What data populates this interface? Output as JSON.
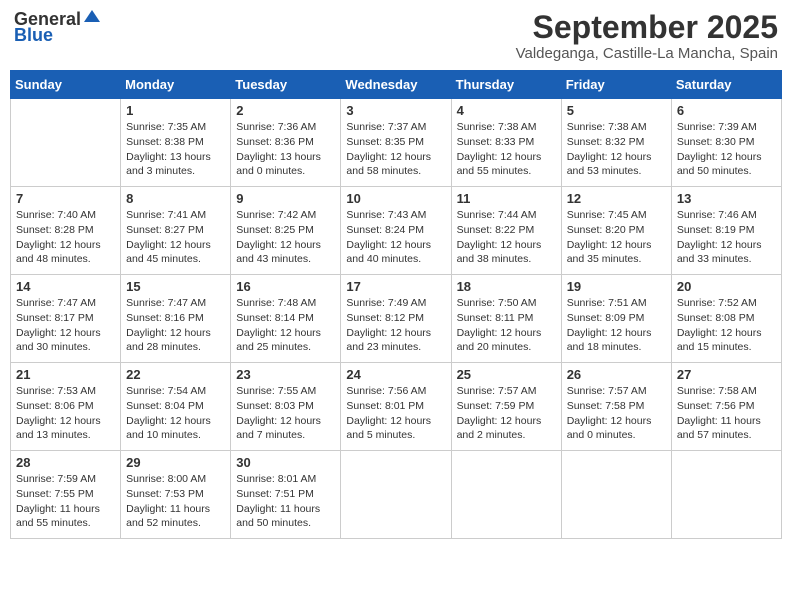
{
  "header": {
    "logo_general": "General",
    "logo_blue": "Blue",
    "month_title": "September 2025",
    "location": "Valdeganga, Castille-La Mancha, Spain"
  },
  "days_of_week": [
    "Sunday",
    "Monday",
    "Tuesday",
    "Wednesday",
    "Thursday",
    "Friday",
    "Saturday"
  ],
  "weeks": [
    [
      {
        "day": "",
        "info": ""
      },
      {
        "day": "1",
        "info": "Sunrise: 7:35 AM\nSunset: 8:38 PM\nDaylight: 13 hours\nand 3 minutes."
      },
      {
        "day": "2",
        "info": "Sunrise: 7:36 AM\nSunset: 8:36 PM\nDaylight: 13 hours\nand 0 minutes."
      },
      {
        "day": "3",
        "info": "Sunrise: 7:37 AM\nSunset: 8:35 PM\nDaylight: 12 hours\nand 58 minutes."
      },
      {
        "day": "4",
        "info": "Sunrise: 7:38 AM\nSunset: 8:33 PM\nDaylight: 12 hours\nand 55 minutes."
      },
      {
        "day": "5",
        "info": "Sunrise: 7:38 AM\nSunset: 8:32 PM\nDaylight: 12 hours\nand 53 minutes."
      },
      {
        "day": "6",
        "info": "Sunrise: 7:39 AM\nSunset: 8:30 PM\nDaylight: 12 hours\nand 50 minutes."
      }
    ],
    [
      {
        "day": "7",
        "info": "Sunrise: 7:40 AM\nSunset: 8:28 PM\nDaylight: 12 hours\nand 48 minutes."
      },
      {
        "day": "8",
        "info": "Sunrise: 7:41 AM\nSunset: 8:27 PM\nDaylight: 12 hours\nand 45 minutes."
      },
      {
        "day": "9",
        "info": "Sunrise: 7:42 AM\nSunset: 8:25 PM\nDaylight: 12 hours\nand 43 minutes."
      },
      {
        "day": "10",
        "info": "Sunrise: 7:43 AM\nSunset: 8:24 PM\nDaylight: 12 hours\nand 40 minutes."
      },
      {
        "day": "11",
        "info": "Sunrise: 7:44 AM\nSunset: 8:22 PM\nDaylight: 12 hours\nand 38 minutes."
      },
      {
        "day": "12",
        "info": "Sunrise: 7:45 AM\nSunset: 8:20 PM\nDaylight: 12 hours\nand 35 minutes."
      },
      {
        "day": "13",
        "info": "Sunrise: 7:46 AM\nSunset: 8:19 PM\nDaylight: 12 hours\nand 33 minutes."
      }
    ],
    [
      {
        "day": "14",
        "info": "Sunrise: 7:47 AM\nSunset: 8:17 PM\nDaylight: 12 hours\nand 30 minutes."
      },
      {
        "day": "15",
        "info": "Sunrise: 7:47 AM\nSunset: 8:16 PM\nDaylight: 12 hours\nand 28 minutes."
      },
      {
        "day": "16",
        "info": "Sunrise: 7:48 AM\nSunset: 8:14 PM\nDaylight: 12 hours\nand 25 minutes."
      },
      {
        "day": "17",
        "info": "Sunrise: 7:49 AM\nSunset: 8:12 PM\nDaylight: 12 hours\nand 23 minutes."
      },
      {
        "day": "18",
        "info": "Sunrise: 7:50 AM\nSunset: 8:11 PM\nDaylight: 12 hours\nand 20 minutes."
      },
      {
        "day": "19",
        "info": "Sunrise: 7:51 AM\nSunset: 8:09 PM\nDaylight: 12 hours\nand 18 minutes."
      },
      {
        "day": "20",
        "info": "Sunrise: 7:52 AM\nSunset: 8:08 PM\nDaylight: 12 hours\nand 15 minutes."
      }
    ],
    [
      {
        "day": "21",
        "info": "Sunrise: 7:53 AM\nSunset: 8:06 PM\nDaylight: 12 hours\nand 13 minutes."
      },
      {
        "day": "22",
        "info": "Sunrise: 7:54 AM\nSunset: 8:04 PM\nDaylight: 12 hours\nand 10 minutes."
      },
      {
        "day": "23",
        "info": "Sunrise: 7:55 AM\nSunset: 8:03 PM\nDaylight: 12 hours\nand 7 minutes."
      },
      {
        "day": "24",
        "info": "Sunrise: 7:56 AM\nSunset: 8:01 PM\nDaylight: 12 hours\nand 5 minutes."
      },
      {
        "day": "25",
        "info": "Sunrise: 7:57 AM\nSunset: 7:59 PM\nDaylight: 12 hours\nand 2 minutes."
      },
      {
        "day": "26",
        "info": "Sunrise: 7:57 AM\nSunset: 7:58 PM\nDaylight: 12 hours\nand 0 minutes."
      },
      {
        "day": "27",
        "info": "Sunrise: 7:58 AM\nSunset: 7:56 PM\nDaylight: 11 hours\nand 57 minutes."
      }
    ],
    [
      {
        "day": "28",
        "info": "Sunrise: 7:59 AM\nSunset: 7:55 PM\nDaylight: 11 hours\nand 55 minutes."
      },
      {
        "day": "29",
        "info": "Sunrise: 8:00 AM\nSunset: 7:53 PM\nDaylight: 11 hours\nand 52 minutes."
      },
      {
        "day": "30",
        "info": "Sunrise: 8:01 AM\nSunset: 7:51 PM\nDaylight: 11 hours\nand 50 minutes."
      },
      {
        "day": "",
        "info": ""
      },
      {
        "day": "",
        "info": ""
      },
      {
        "day": "",
        "info": ""
      },
      {
        "day": "",
        "info": ""
      }
    ]
  ]
}
